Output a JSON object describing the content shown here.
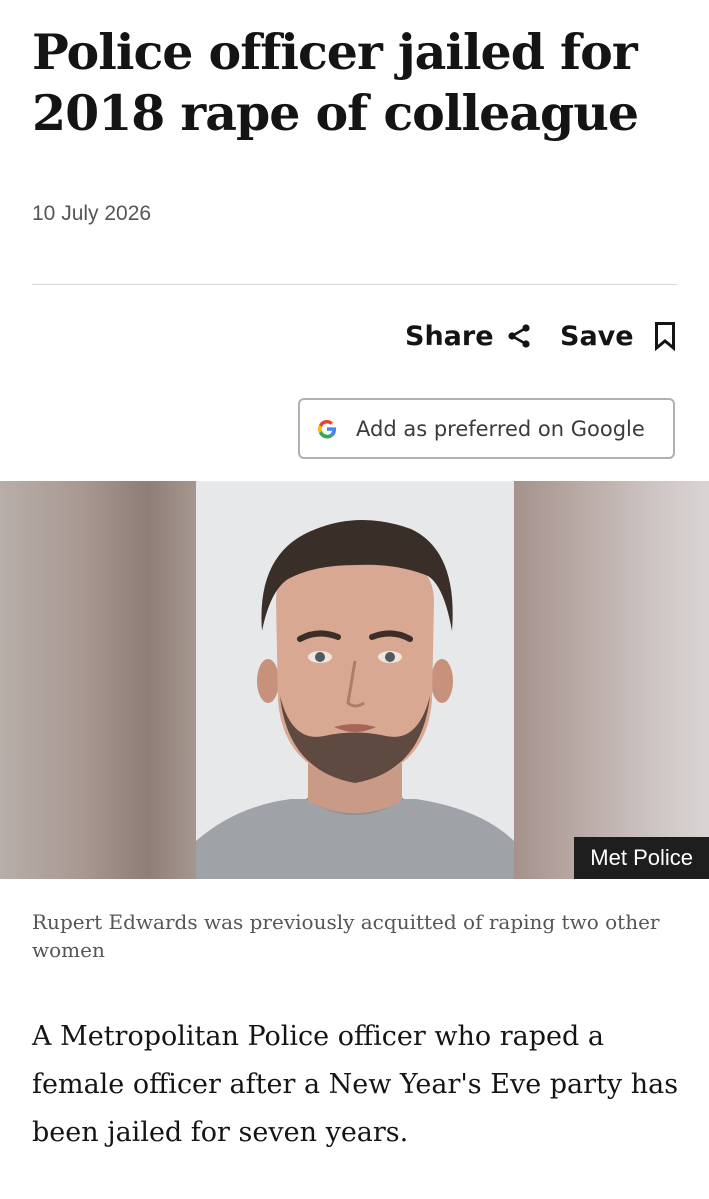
{
  "article": {
    "headline": "Police officer jailed for 2018 rape of colleague",
    "date": "10 July 2026"
  },
  "actions": {
    "share_label": "Share",
    "share_icon": "share-icon",
    "save_label": "Save",
    "save_icon": "bookmark-icon"
  },
  "google_button": {
    "label": "Add as preferred on Google",
    "icon": "google-g-icon"
  },
  "image": {
    "credit": "Met Police",
    "caption": "Rupert Edwards was previously acquitted of raping two other women"
  },
  "body": {
    "lede": "A Metropolitan Police officer who raped a female officer after a New Year's Eve party has been jailed for seven years."
  },
  "colors": {
    "text": "#141414",
    "muted": "#545658",
    "divider": "#d6d6d6",
    "credit_bg": "#1e1e1e"
  }
}
